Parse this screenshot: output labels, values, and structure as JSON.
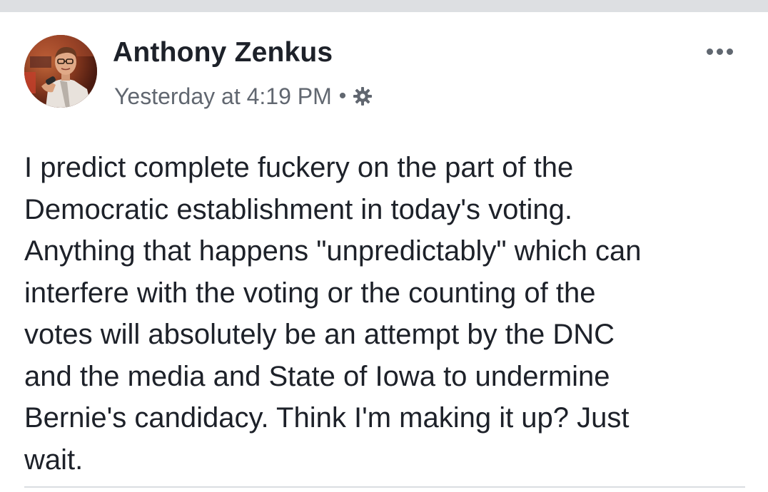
{
  "post": {
    "author_name": "Anthony Zenkus",
    "timestamp": "Yesterday at 4:19 PM",
    "separator": "•",
    "privacy_icon": "gear-icon",
    "more_icon": "more-options-icon",
    "body_lines": [
      "I predict complete fuckery on the part of the",
      "Democratic establishment in today's voting.",
      "Anything that happens \"unpredictably\" which can",
      "interfere with the voting or the counting of the",
      "votes will absolutely be an attempt by the DNC",
      "and the media and State of Iowa to undermine",
      "Bernie's candidacy. Think I'm making it up? Just",
      "wait."
    ]
  },
  "colors": {
    "background": "#ffffff",
    "top_band": "#dddfe2",
    "author_text": "#1d2129",
    "meta_text": "#616770",
    "body_text": "#1d2129"
  }
}
